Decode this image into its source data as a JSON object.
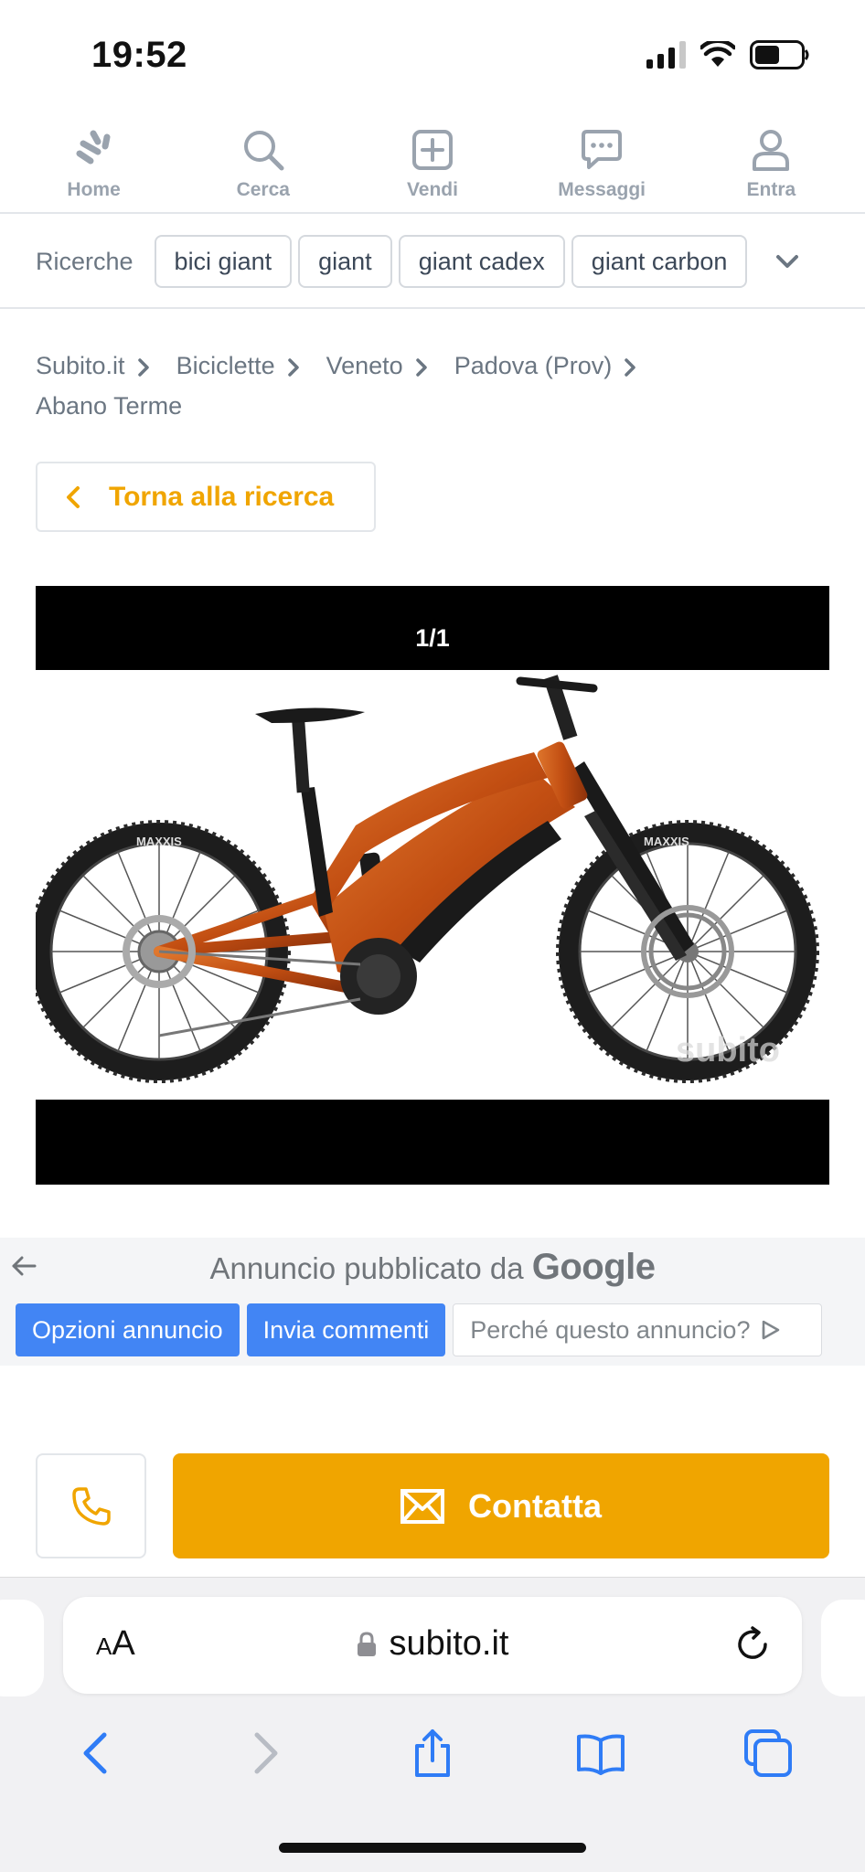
{
  "status_bar": {
    "time": "19:52",
    "signal_icon": "cellular-signal-icon",
    "wifi_icon": "wifi-icon",
    "battery_icon": "battery-icon"
  },
  "top_nav": {
    "items": [
      {
        "label": "Home",
        "icon": "home-icon"
      },
      {
        "label": "Cerca",
        "icon": "search-icon"
      },
      {
        "label": "Vendi",
        "icon": "add-icon"
      },
      {
        "label": "Messaggi",
        "icon": "messages-icon"
      },
      {
        "label": "Entra",
        "icon": "user-icon"
      }
    ]
  },
  "searches": {
    "label": "Ricerche",
    "chips": [
      "bici giant",
      "giant",
      "giant cadex",
      "giant carbon"
    ]
  },
  "breadcrumb": [
    "Subito.it",
    "Biciclette",
    "Veneto",
    "Padova (Prov)",
    "Abano Terme"
  ],
  "back_button": {
    "label": "Torna alla ricerca"
  },
  "gallery": {
    "counter": "1/1",
    "tire_brand": "MAXXIS",
    "watermark": "subito"
  },
  "google_ad": {
    "title_prefix": "Annuncio pubblicato da",
    "title_brand": "Google",
    "buttons": [
      "Opzioni annuncio",
      "Invia commenti",
      "Perché questo annuncio?"
    ]
  },
  "contact": {
    "label": "Contatta"
  },
  "colors": {
    "accent": "#f0a500",
    "google_blue": "#4285f4",
    "bike_orange": "#c24e12"
  },
  "safari": {
    "text_size_small": "A",
    "text_size_big": "A",
    "url": "subito.it"
  }
}
